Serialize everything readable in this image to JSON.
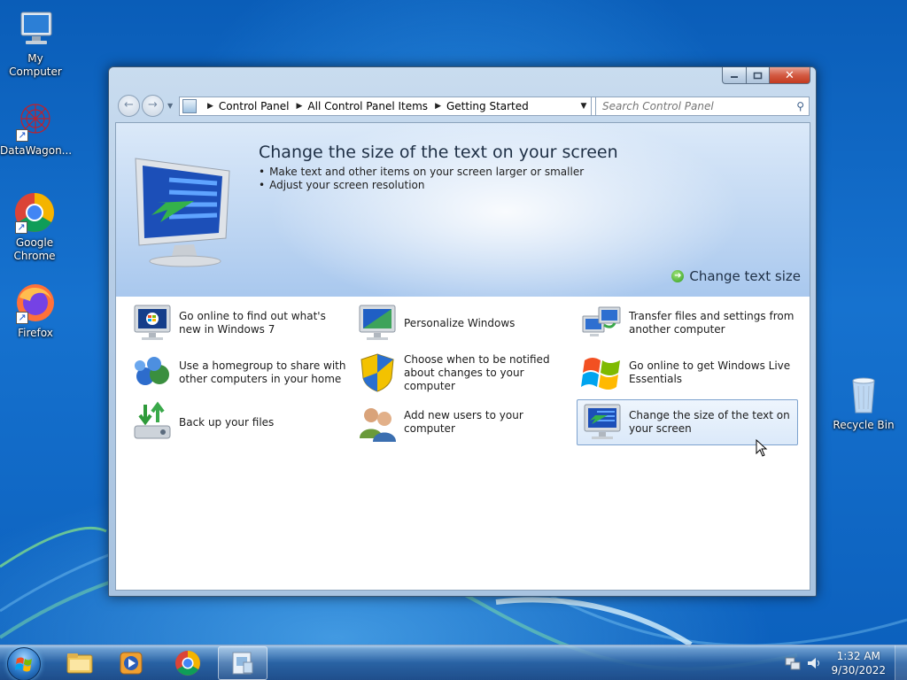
{
  "desktop": {
    "icons": [
      {
        "label": "My Computer"
      },
      {
        "label": "DataWagon..."
      },
      {
        "label": "Google Chrome"
      },
      {
        "label": "Firefox"
      },
      {
        "label": "Recycle Bin"
      }
    ]
  },
  "window": {
    "breadcrumb": [
      "Control Panel",
      "All Control Panel Items",
      "Getting Started"
    ],
    "search_placeholder": "Search Control Panel",
    "banner": {
      "title": "Change the size of the text on your screen",
      "bullets": [
        "Make text and other items on your screen larger or smaller",
        "Adjust your screen resolution"
      ],
      "link": "Change text size"
    },
    "tasks": [
      {
        "label": "Go online to find out what's new in Windows 7",
        "icon": "windows7-monitor-icon",
        "selected": false
      },
      {
        "label": "Personalize Windows",
        "icon": "personalize-monitor-icon",
        "selected": false
      },
      {
        "label": "Transfer files and settings from another computer",
        "icon": "transfer-computers-icon",
        "selected": false
      },
      {
        "label": "Use a homegroup to share with other computers in your home",
        "icon": "homegroup-icon",
        "selected": false
      },
      {
        "label": "Choose when to be notified about changes to your computer",
        "icon": "uac-shield-icon",
        "selected": false
      },
      {
        "label": "Go online to get Windows Live Essentials",
        "icon": "windows-flag-icon",
        "selected": false
      },
      {
        "label": "Back up your files",
        "icon": "backup-drive-icon",
        "selected": false
      },
      {
        "label": "Add new users to your computer",
        "icon": "users-icon",
        "selected": false
      },
      {
        "label": "Change the size of the text on your screen",
        "icon": "text-size-monitor-icon",
        "selected": true
      }
    ]
  },
  "taskbar": {
    "time": "1:32 AM",
    "date": "9/30/2022"
  },
  "colors": {
    "desktop": "#1672cf",
    "selection": "#dbe9f9",
    "close_button": "#c33a1f"
  }
}
